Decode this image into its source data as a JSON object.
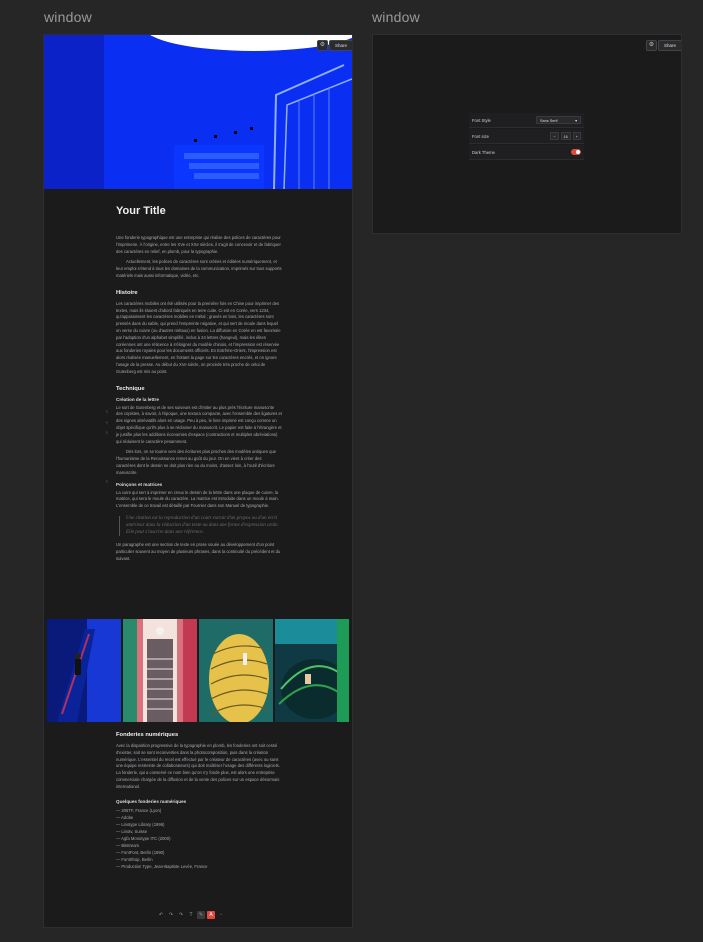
{
  "labels": {
    "left_window": "window",
    "right_window": "window"
  },
  "hero": {
    "share_label": "Share"
  },
  "article": {
    "title": "Your Title",
    "intro": [
      "Une fonderie typographique est une entreprise qui réalise des polices de caractères pour l'imprimerie. À l'origine, entre les XVe et XXe siècles, il s'agit de concevoir et de fabriquer des caractères en relief, en plomb, pour la typographie.",
      "Actuellement, les polices de caractères sont créées et éditées numériquement, et leur emploi s'étend à tous les domaines de la communication, imprimés sur tous supports matériels mais aussi informatique, vidéo, etc."
    ],
    "histoire_title": "Histoire",
    "histoire_text": "Les caractères mobiles ont été utilisés pour la première fois en Chine pour imprimer des textes, mais ils étaient d'abord fabriqués en terre cuite. Ci est en Corée, vers 1234, qu'apparaissent les caractères mobiles en métal ; gravés en bois, les caractères sont pressés dans du sable, qui prend l'empreinte négative, et qui sert de moule dans lequel on verse du cuivre (ou d'autres métaux) en fusion. La diffusion en Corée en est favorisée par l'adoption d'un alphabet simplifié, inclus à 24 lettres (hangeul), mais les élites coréennes ont une réticence à s'éloigner du modèle chinois, et l'impression est réservée aux fonderies royales pour les documents officiels. En Extrême-Orient, l'impression est alors réalisée manuellement, en frottant la page sur les caractères encrés, et on ignore l'usage de la presse. Au début du XVe siècle, on procède très proche de celui de Gutenberg est mis au point.",
    "technique_title": "Technique",
    "creation_title": "Création de la lettre",
    "creation_text": [
      "Le sort de Gutenberg et de ses suiveurs est d'imiter au plus près l'écriture manuscrite des copistes, à savoir, à l'époque, une textura compacte, avec l'ensemble des ligatures et des signes abréviatifs alors en usage. Peu à peu, le livre imprimé est conçu comme un objet spécifique qu'il's plus à se réclamer du manuscrit. Le papier est faite à l'étrangère et je justifie plus les additions économies d'espace (contractions et multiples abréviations) qui réduisent le caractère pesamment.",
      "Dès lors, on se tourne vers des écritures plus proches des modèles antiques que l'humanisme de la Renaissance remet au goût du jour. On en vient à créer des caractères dont le dessin ne doit plus rien ou du moins, d'assez loin, à l'outil d'écriture manuscrite."
    ],
    "poincons_title": "Poinçons et matrices",
    "poincons_text": "La cuire qui sert à imprimer en creux le dessin de la lettre dans une plaque de cuivre, la matrice, qui sera le moule du caractère. La matrice est introduite dans un moule à main. L'ensemble de ce travail est détaillé par Fournier dans son Manuel de typographie.",
    "quote": "Une citation est la reproduction d'un court extrait d'un propos ou d'un écrit antérieur dans la rédaction d'un texte ou dans une forme d'expression orale. Elle peut s'inscrire dans une référence.",
    "paragraph_text": "Un paragraphe est une section de texte en prose vouée au développement d'un point particulier souvent au moyen de plusieurs phrases, dans la continuité du précédent et du suivant.",
    "fonderies_title": "Fonderies numériques",
    "fonderies_text": "Avec la disparition progressive de la typographie en plomb, les fonderies ont soit cessé d'exister, soit se sont reconverties dans la photocomposition, puis dans la création numérique. L'essentiel du recel est effectué par le créateur de caractères (avec ou sans une équipe restreinte de collaborateurs) qui doit maîtriser l'usage des différents logiciels. La fonderie, qui a conservé ce nom bien qu'on n'y fonde plus, est alors une entreprise commerciale chargée de la diffusion et de la vente des polices sur un espace désormais international.",
    "list_title": "Quelques fonderies numériques",
    "list_items": [
      "— 205TF, France (Lyon)",
      "— Adobe",
      "— Linotype Library (1996)",
      "— Linotv, Suisse",
      "— Agfa Monotype ITC (2000)",
      "— Bitstream",
      "— FontFont, Berlin (1990)",
      "— FontShop, Berlin",
      "— Production Type, Jean-Baptiste Levée, France"
    ]
  },
  "settings": {
    "font_style_label": "Font Style",
    "font_style_value": "Sans Serif",
    "font_size_label": "Font size",
    "font_size_value": "16",
    "dark_theme_label": "Dark Theme",
    "dark_theme_on": true
  },
  "colors": {
    "accent": "#e5483a",
    "hero_blue": "#0a2cf0"
  }
}
